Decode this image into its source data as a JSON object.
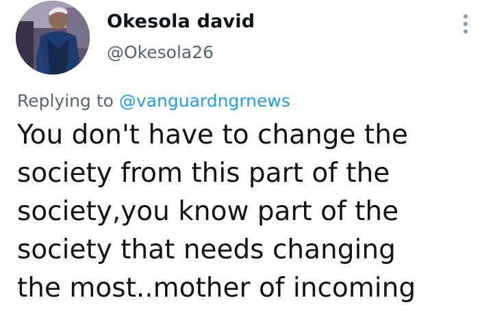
{
  "author": {
    "name": "Okesola david",
    "handle": "@Okesola26"
  },
  "reply": {
    "prefix": "Replying to",
    "target": "@vanguardngrnews"
  },
  "tweet": {
    "lines": [
      "You don't have to change the",
      "society from this part of the",
      "society,you know part of the",
      "society that needs changing",
      "the most..mother of incoming"
    ]
  },
  "icons": {
    "more": "more-vertical-icon"
  },
  "colors": {
    "link": "#1d9bf0",
    "secondary_text": "#536471",
    "primary_text": "#0f1419"
  }
}
